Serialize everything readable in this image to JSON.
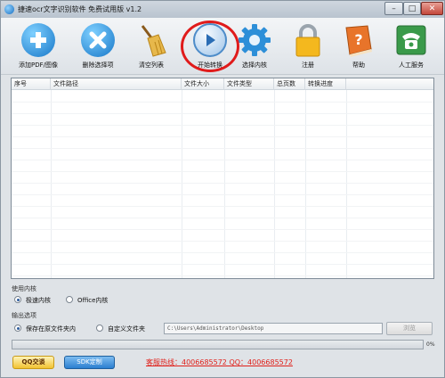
{
  "window": {
    "title": "捷速ocr文字识别软件 免费试用版 v1.2",
    "controls": {
      "minimize": "–",
      "maximize": "□",
      "close": "✕"
    }
  },
  "toolbar": {
    "items": [
      {
        "label": "添加PDF/图像",
        "icon": "add-icon",
        "color": "#1f8fd6"
      },
      {
        "label": "删除选择项",
        "icon": "delete-icon",
        "color": "#1f8fd6"
      },
      {
        "label": "清空列表",
        "icon": "broom-icon",
        "color": "#d9a53a"
      },
      {
        "label": "开始转换",
        "icon": "play-icon",
        "color": "#2f7fc8"
      },
      {
        "label": "选择内核",
        "icon": "gear-icon",
        "color": "#2d8fd8"
      },
      {
        "label": "注册",
        "icon": "lock-icon",
        "color": "#f0b21c"
      },
      {
        "label": "帮助",
        "icon": "help-book-icon",
        "color": "#e26a1c"
      },
      {
        "label": "人工服务",
        "icon": "phone-icon",
        "color": "#3a9a4a"
      }
    ]
  },
  "file_list": {
    "columns": [
      "序号",
      "文件路径",
      "文件大小",
      "文件类型",
      "总页数",
      "转换进度"
    ],
    "rows": []
  },
  "engine": {
    "section_label": "使用内核",
    "options": [
      {
        "label": "极速内核",
        "checked": true
      },
      {
        "label": "Office内核",
        "checked": false
      }
    ]
  },
  "output": {
    "section_label": "输出选项",
    "options": [
      {
        "label": "保存在原文件夹内",
        "checked": true
      },
      {
        "label": "自定义文件夹",
        "checked": false
      }
    ],
    "path_value": "C:\\Users\\Administrator\\Desktop",
    "browse_label": "浏览"
  },
  "progress": {
    "value": 0,
    "text": "0%"
  },
  "footer": {
    "qq_button": "QQ交谈",
    "sdk_button": "SDK定制",
    "hotline": "客服热线：4006685572 QQ：4006685572"
  }
}
